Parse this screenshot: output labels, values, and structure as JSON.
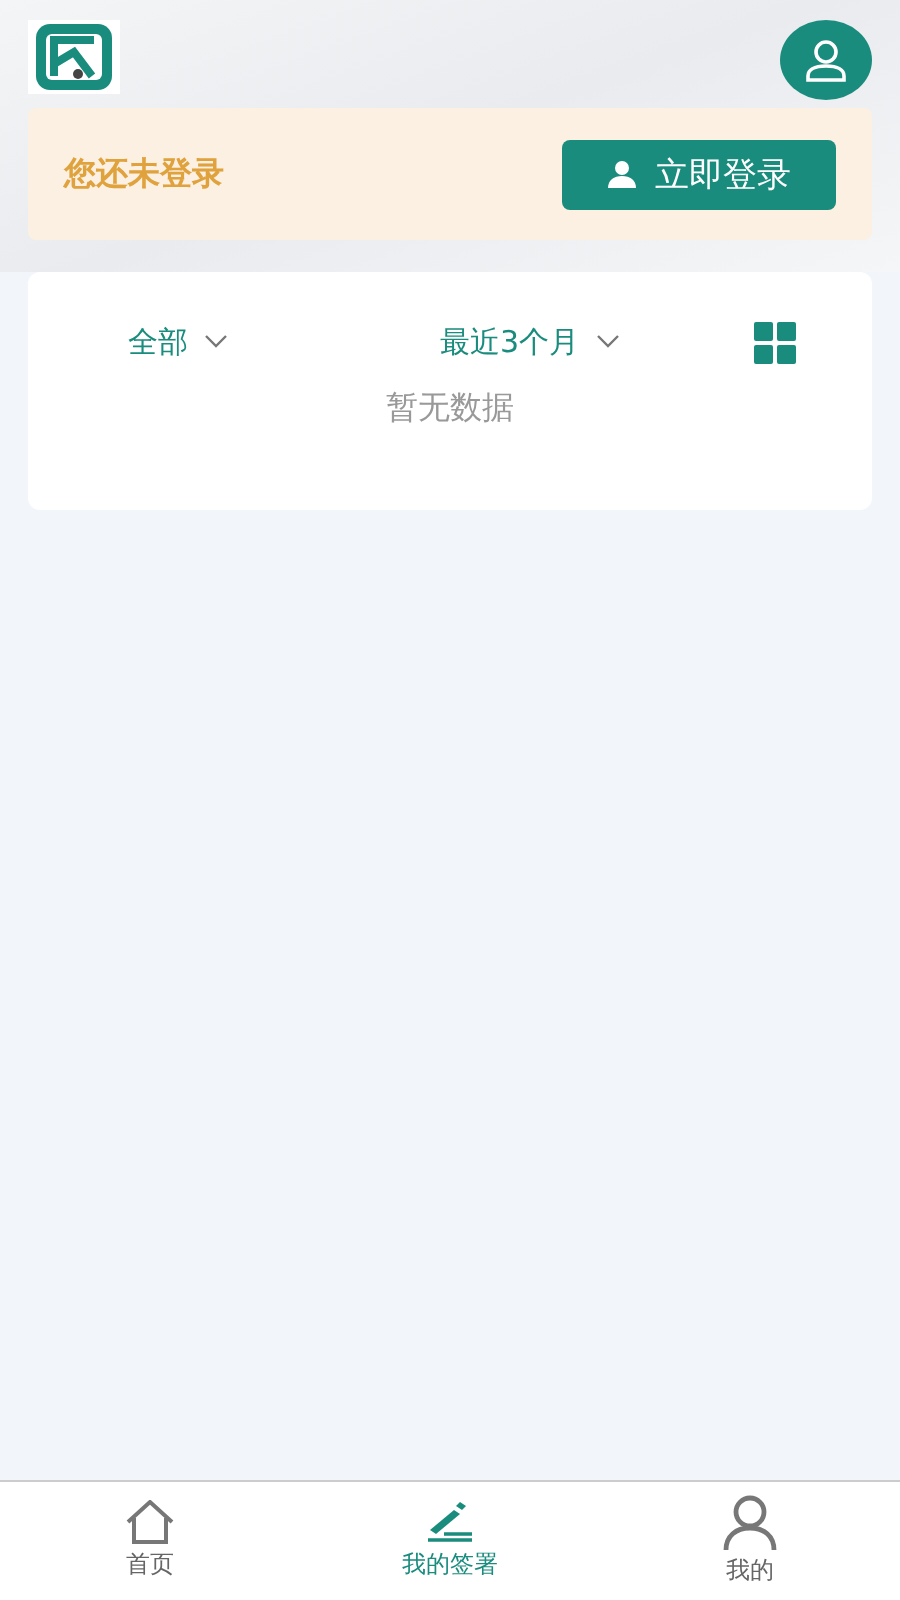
{
  "login_banner": {
    "message": "您还未登录",
    "button": "立即登录"
  },
  "filters": [
    {
      "label": "全部",
      "kind": "dropdown"
    },
    {
      "label": "最近3个月",
      "kind": "dropdown"
    }
  ],
  "empty_state": "暂无数据",
  "tab_bar": [
    {
      "label": "首页",
      "kind": "home",
      "selected": false
    },
    {
      "label": "我的签署",
      "kind": "sign",
      "selected": true
    },
    {
      "label": "我的",
      "kind": "profile",
      "selected": false
    }
  ]
}
